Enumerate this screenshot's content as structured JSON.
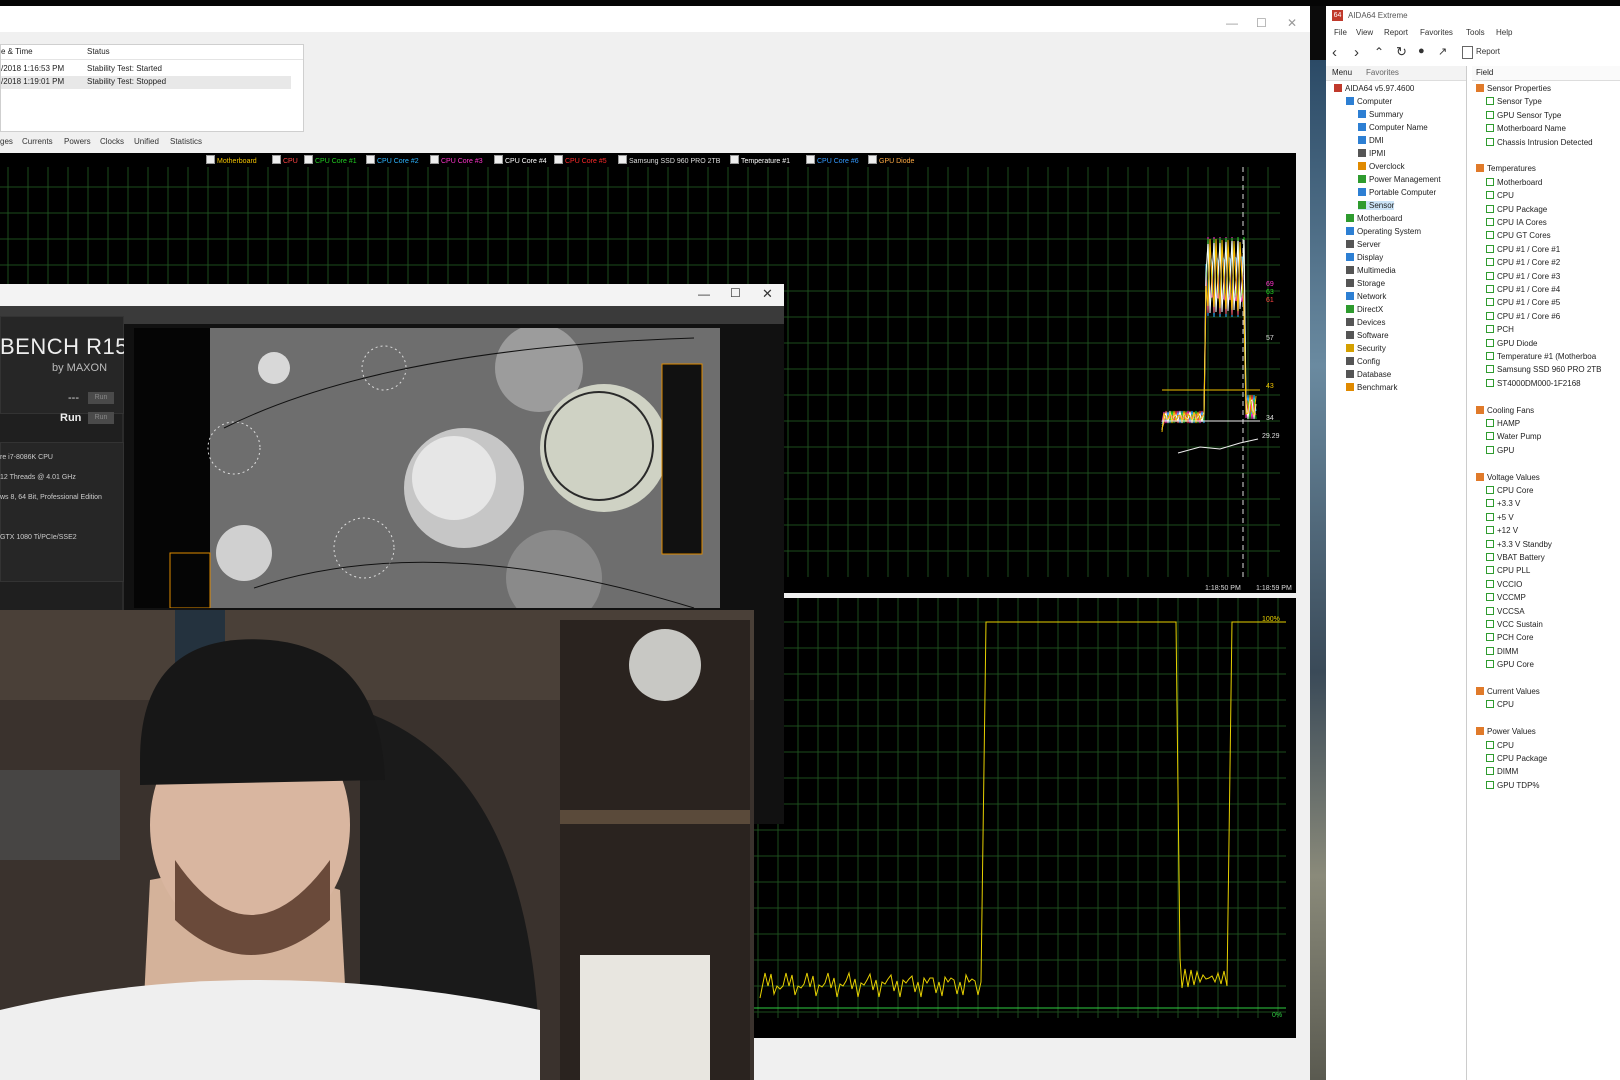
{
  "stability": {
    "log": {
      "headers": [
        "e & Time",
        "Status"
      ],
      "rows": [
        {
          "time": "/2018 1:16:53 PM",
          "status": "Stability Test: Started"
        },
        {
          "time": "/2018 1:19:01 PM",
          "status": "Stability Test: Stopped"
        }
      ]
    },
    "tabs": [
      "ges",
      "Currents",
      "Powers",
      "Clocks",
      "Unified",
      "Statistics"
    ],
    "legend": [
      {
        "label": "Motherboard",
        "color": "#f2c200"
      },
      {
        "label": "CPU",
        "color": "#ff4444"
      },
      {
        "label": "CPU Core #1",
        "color": "#22cc22"
      },
      {
        "label": "CPU Core #2",
        "color": "#2db4ff"
      },
      {
        "label": "CPU Core #3",
        "color": "#ff33cc"
      },
      {
        "label": "CPU Core #4",
        "color": "#ffffff"
      },
      {
        "label": "CPU Core #5",
        "color": "#ff2a2a"
      },
      {
        "label": "Samsung SSD 960 PRO 2TB",
        "color": "#dddddd"
      },
      {
        "label": "Temperature #1",
        "color": "#ffffff"
      },
      {
        "label": "CPU Core #6",
        "color": "#3399ff"
      },
      {
        "label": "GPU Diode",
        "color": "#ffaa44"
      }
    ],
    "temp_graph": {
      "right_values": [
        "69",
        "63",
        "61",
        "57",
        "43",
        "34",
        "29.29"
      ],
      "time_start": "1:18:50 PM",
      "time_end": "1:18:59 PM"
    },
    "usage_graph": {
      "top_label": "100%",
      "bottom_label": "0%"
    }
  },
  "cinebench": {
    "logo": "BENCH R15",
    "by": "by MAXON",
    "cpu_dots": "---",
    "run_label": "Run",
    "run_btn": "Run",
    "info": [
      "re i7-8086K CPU",
      "12 Threads @ 4.01 GHz",
      "ws 8, 64 Bit, Professional Edition",
      "GTX 1080 Ti/PCIe/SSE2"
    ]
  },
  "aida": {
    "title": "AIDA64 Extreme",
    "menu": [
      "File",
      "View",
      "Report",
      "Favorites",
      "Tools",
      "Help"
    ],
    "report_label": "Report",
    "tabs": [
      "Menu",
      "Favorites"
    ],
    "field_header": "Field",
    "tree": [
      {
        "label": "AIDA64 v5.97.4600",
        "level": 0,
        "color": "#c0392b"
      },
      {
        "label": "Computer",
        "level": 1,
        "color": "#2d7fd3"
      },
      {
        "label": "Summary",
        "level": 2,
        "color": "#2d7fd3"
      },
      {
        "label": "Computer Name",
        "level": 2,
        "color": "#2d7fd3"
      },
      {
        "label": "DMI",
        "level": 2,
        "color": "#2d7fd3"
      },
      {
        "label": "IPMI",
        "level": 2,
        "color": "#555555"
      },
      {
        "label": "Overclock",
        "level": 2,
        "color": "#e08a00"
      },
      {
        "label": "Power Management",
        "level": 2,
        "color": "#2e9b2e"
      },
      {
        "label": "Portable Computer",
        "level": 2,
        "color": "#2d7fd3"
      },
      {
        "label": "Sensor",
        "level": 2,
        "color": "#2e9b2e"
      },
      {
        "label": "Motherboard",
        "level": 1,
        "color": "#2e9b2e"
      },
      {
        "label": "Operating System",
        "level": 1,
        "color": "#2d7fd3"
      },
      {
        "label": "Server",
        "level": 1,
        "color": "#555555"
      },
      {
        "label": "Display",
        "level": 1,
        "color": "#2d7fd3"
      },
      {
        "label": "Multimedia",
        "level": 1,
        "color": "#555555"
      },
      {
        "label": "Storage",
        "level": 1,
        "color": "#555555"
      },
      {
        "label": "Network",
        "level": 1,
        "color": "#2d7fd3"
      },
      {
        "label": "DirectX",
        "level": 1,
        "color": "#2e9b2e"
      },
      {
        "label": "Devices",
        "level": 1,
        "color": "#555555"
      },
      {
        "label": "Software",
        "level": 1,
        "color": "#555555"
      },
      {
        "label": "Security",
        "level": 1,
        "color": "#d4a000"
      },
      {
        "label": "Config",
        "level": 1,
        "color": "#555555"
      },
      {
        "label": "Database",
        "level": 1,
        "color": "#555555"
      },
      {
        "label": "Benchmark",
        "level": 1,
        "color": "#e08a00"
      }
    ],
    "fields": [
      {
        "label": "Sensor Properties",
        "group": true
      },
      {
        "label": "Sensor Type"
      },
      {
        "label": "GPU Sensor Type"
      },
      {
        "label": "Motherboard Name"
      },
      {
        "label": "Chassis Intrusion Detected"
      },
      {
        "label": "",
        "spacer": true
      },
      {
        "label": "Temperatures",
        "group": true
      },
      {
        "label": "Motherboard"
      },
      {
        "label": "CPU"
      },
      {
        "label": "CPU Package"
      },
      {
        "label": "CPU IA Cores"
      },
      {
        "label": "CPU GT Cores"
      },
      {
        "label": "CPU #1 / Core #1"
      },
      {
        "label": "CPU #1 / Core #2"
      },
      {
        "label": "CPU #1 / Core #3"
      },
      {
        "label": "CPU #1 / Core #4"
      },
      {
        "label": "CPU #1 / Core #5"
      },
      {
        "label": "CPU #1 / Core #6"
      },
      {
        "label": "PCH"
      },
      {
        "label": "GPU Diode"
      },
      {
        "label": "Temperature #1 (Motherboa"
      },
      {
        "label": "Samsung SSD 960 PRO 2TB"
      },
      {
        "label": "ST4000DM000-1F2168"
      },
      {
        "label": "",
        "spacer": true
      },
      {
        "label": "Cooling Fans",
        "group": true
      },
      {
        "label": "HAMP"
      },
      {
        "label": "Water Pump"
      },
      {
        "label": "GPU"
      },
      {
        "label": "",
        "spacer": true
      },
      {
        "label": "Voltage Values",
        "group": true
      },
      {
        "label": "CPU Core"
      },
      {
        "label": "+3.3 V"
      },
      {
        "label": "+5 V"
      },
      {
        "label": "+12 V"
      },
      {
        "label": "+3.3 V Standby"
      },
      {
        "label": "VBAT Battery"
      },
      {
        "label": "CPU PLL"
      },
      {
        "label": "VCCIO"
      },
      {
        "label": "VCCMP"
      },
      {
        "label": "VCCSA"
      },
      {
        "label": "VCC Sustain"
      },
      {
        "label": "PCH Core"
      },
      {
        "label": "DIMM"
      },
      {
        "label": "GPU Core"
      },
      {
        "label": "",
        "spacer": true
      },
      {
        "label": "Current Values",
        "group": true
      },
      {
        "label": "CPU"
      },
      {
        "label": "",
        "spacer": true
      },
      {
        "label": "Power Values",
        "group": true
      },
      {
        "label": "CPU"
      },
      {
        "label": "CPU Package"
      },
      {
        "label": "DIMM"
      },
      {
        "label": "GPU TDP%"
      }
    ]
  }
}
